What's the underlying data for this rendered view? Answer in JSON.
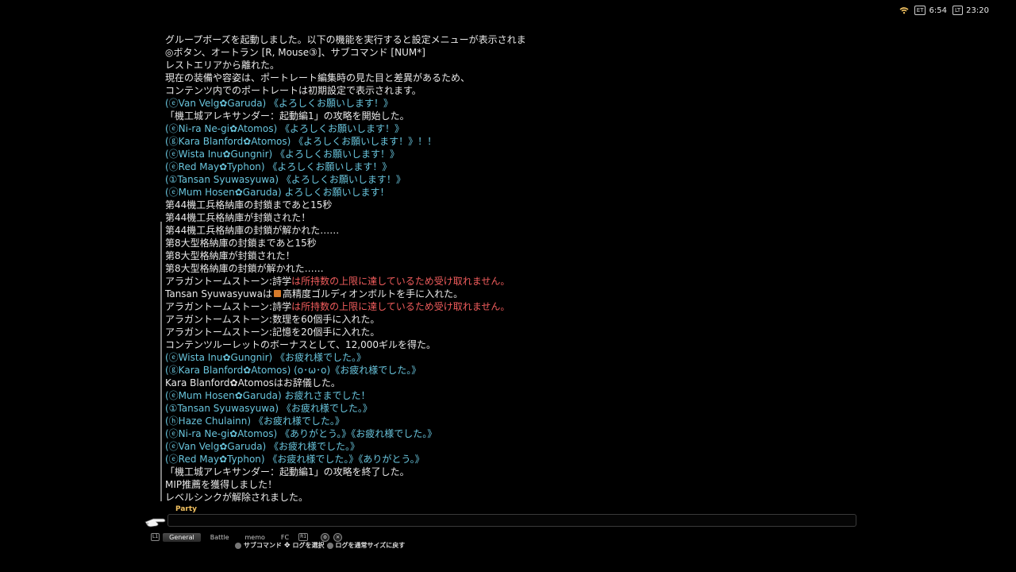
{
  "status": {
    "clock1_label": "ET",
    "clock1": "6:54",
    "clock2_label": "LT",
    "clock2": "23:20"
  },
  "chat": [
    "グループポーズを起動しました。以下の機能を実行すると設定メニューが表示されます。",
    "◎ボタン、オートラン [R, Mouse③]、サブコマンド [NUM*]",
    "レストエリアから離れた。",
    "現在の装備や容姿は、ポートレート編集時の見た目と差異があるため、",
    "コンテンツ内でのポートレートは初期設定で表示されます。",
    "(ⓔVan Velg✿Garuda) 《よろしくお願いします！》",
    "「機工城アレキサンダー：起動編1」の攻略を開始した。",
    "(ⓔNi-ra Ne-gi✿Atomos) 《よろしくお願いします！》",
    "(ⓖKara Blanford✿Atomos) 《よろしくお願いします！》！！",
    "(ⓔWista Inu✿Gungnir) 《よろしくお願いします！》",
    "(ⓔRed May✿Typhon) 《よろしくお願いします！》",
    "(①Tansan Syuwasyuwa) 《よろしくお願いします！》",
    "(ⓔMum Hosen✿Garuda) よろしくお願いします！",
    "第44機工兵格納庫の封鎖まであと15秒",
    "第44機工兵格納庫が封鎖された！",
    "第44機工兵格納庫の封鎖が解かれた……",
    "第8大型格納庫の封鎖まであと15秒",
    "第8大型格納庫が封鎖された！",
    "第8大型格納庫の封鎖が解かれた……",
    "アラガントームストーン:詩学",
    "は所持数の上限に達しているため受け取れません。",
    "Tansan Syuwasyuwaは",
    "高精度ゴルディオンボルトを手に入れた。",
    "アラガントームストーン:数理を60個手に入れた。",
    "アラガントームストーン:記憶を20個手に入れた。",
    "コンテンツルーレットのボーナスとして、12,000ギルを得た。",
    "(ⓔWista Inu✿Gungnir) 《お疲れ様でした。》",
    "(ⓖKara Blanford✿Atomos) (o･ω･o)《お疲れ様でした。》",
    "Kara Blanford✿Atomosはお辞儀した。",
    "(ⓔMum Hosen✿Garuda) お疲れさまでした！",
    "(①Tansan Syuwasyuwa) 《お疲れ様でした。》",
    "(ⓗHaze Chulainn) 《お疲れ様でした。》",
    "(ⓔNi-ra Ne-gi✿Atomos) 《ありがとう。》《お疲れ様でした。》",
    "(ⓔVan Velg✿Garuda) 《お疲れ様でした。》",
    "(ⓔRed May✿Typhon) 《お疲れ様でした。》《ありがとう。》",
    "「機工城アレキサンダー：起動編1」の攻略を終了した。",
    "MIP推薦を獲得しました！",
    "レベルシンクが解除されました。"
  ],
  "input": {
    "channel": "Party",
    "value": ""
  },
  "tabs": [
    "General",
    "Battle",
    "memo",
    "FC"
  ],
  "tab_keys": {
    "left": "L1",
    "right": "R1"
  },
  "hints": {
    "subcommand": "サブコマンド",
    "select_log": "ログを選択",
    "reset_size": "ログを通常サイズに戻す"
  },
  "colors": {
    "party": "#69c5dd",
    "system": "#e9e9e9",
    "error": "#f25d5d",
    "channel": "#f0c060"
  }
}
